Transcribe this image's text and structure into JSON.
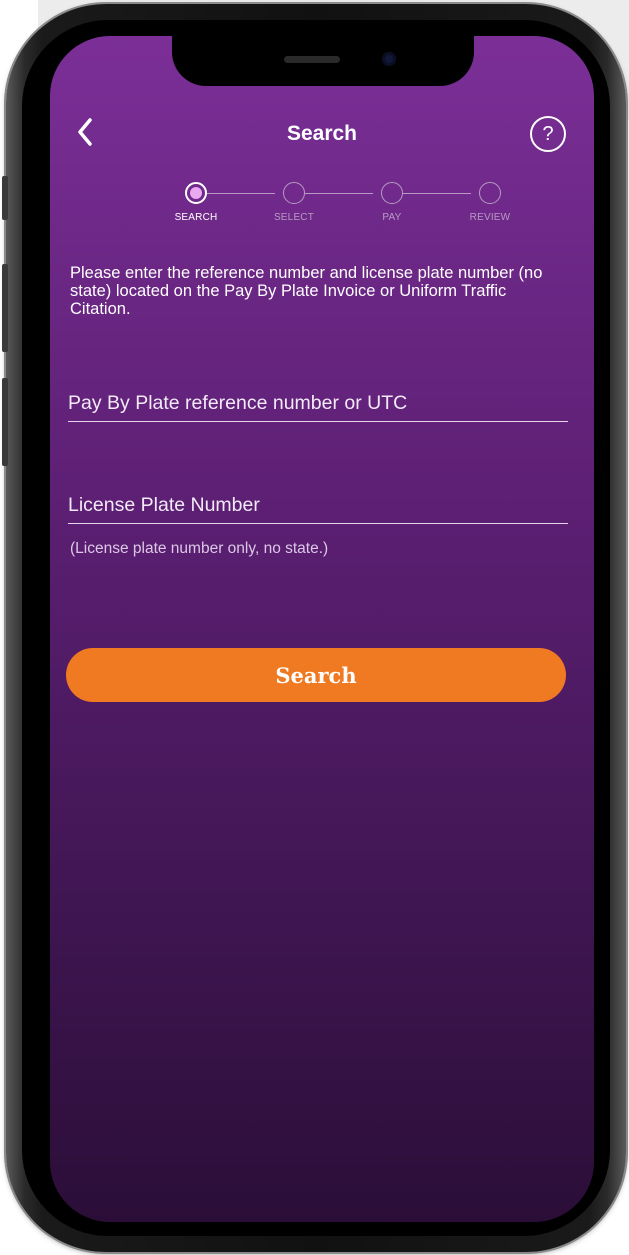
{
  "nav": {
    "title": "Search",
    "back_icon": "chevron-left-icon",
    "help_label": "?"
  },
  "stepper": {
    "steps": [
      {
        "label": "SEARCH",
        "active": true
      },
      {
        "label": "SELECT",
        "active": false
      },
      {
        "label": "PAY",
        "active": false
      },
      {
        "label": "REVIEW",
        "active": false
      }
    ]
  },
  "form": {
    "instructions": "Please enter the reference number and license plate number (no state) located on the Pay By Plate Invoice or Uniform Traffic Citation.",
    "reference_field": {
      "placeholder": "Pay By Plate reference number or UTC",
      "value": ""
    },
    "plate_field": {
      "placeholder": "License Plate Number",
      "value": ""
    },
    "plate_hint": "(License plate number only, no state.)",
    "search_label": "Search"
  },
  "colors": {
    "background_top": "#7b2f97",
    "background_bottom": "#2b0e38",
    "accent": "#f07a22",
    "step_active": "#e9a8f2"
  }
}
